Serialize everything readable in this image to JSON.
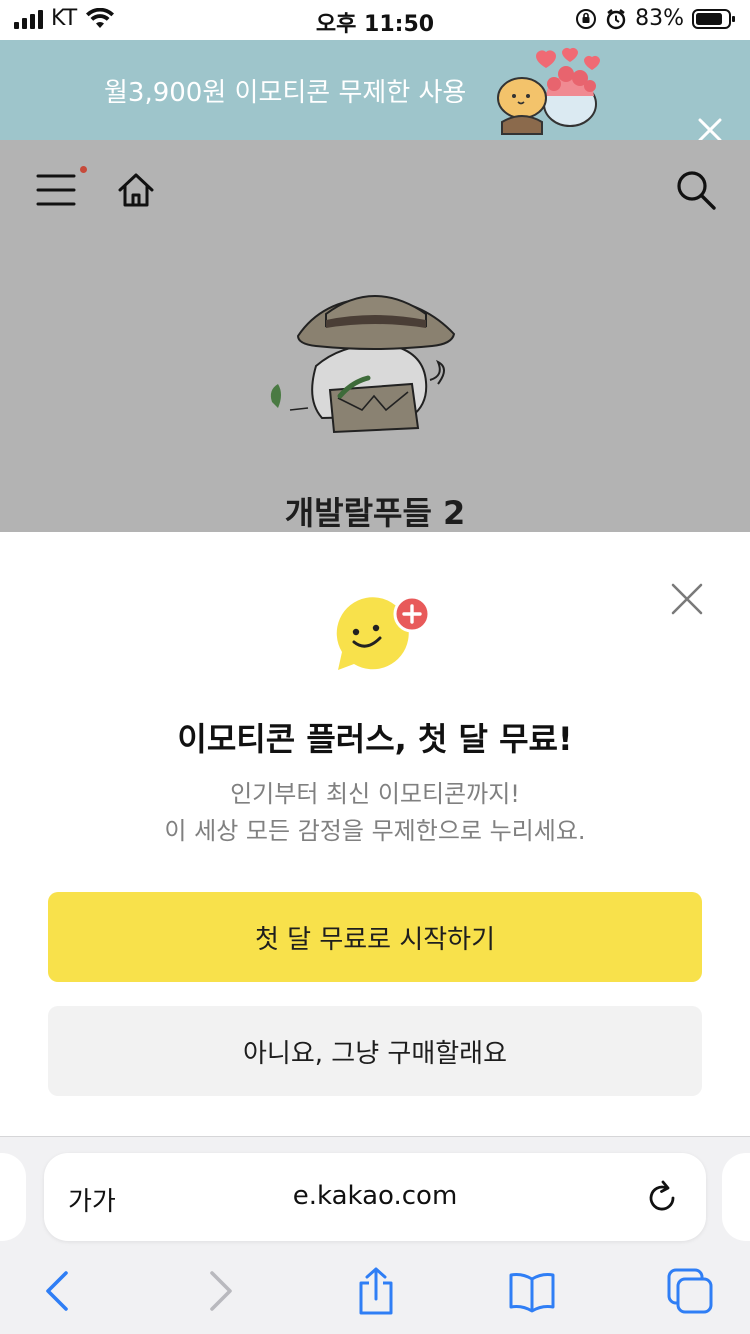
{
  "status_bar": {
    "carrier": "KT",
    "time": "오후 11:50",
    "battery": "83%"
  },
  "promo": {
    "text": "월3,900원 이모티콘 무제한 사용"
  },
  "product": {
    "title": "개발랄푸들 2"
  },
  "sheet": {
    "title": "이모티콘 플러스, 첫 달 무료!",
    "desc_line1": "인기부터 최신 이모티콘까지!",
    "desc_line2": "이 세상 모든 감정을 무제한으로 누리세요.",
    "primary_button": "첫 달 무료로 시작하기",
    "secondary_button": "아니요, 그냥 구매할래요"
  },
  "safari": {
    "text_size_label": "가가",
    "url": "e.kakao.com"
  },
  "colors": {
    "promo_bg": "#9ec5cb",
    "dim_bg": "#b3b3b3",
    "primary_button": "#f8e14b",
    "secondary_button": "#f2f2f2",
    "safari_blue": "#2f7ef5"
  }
}
